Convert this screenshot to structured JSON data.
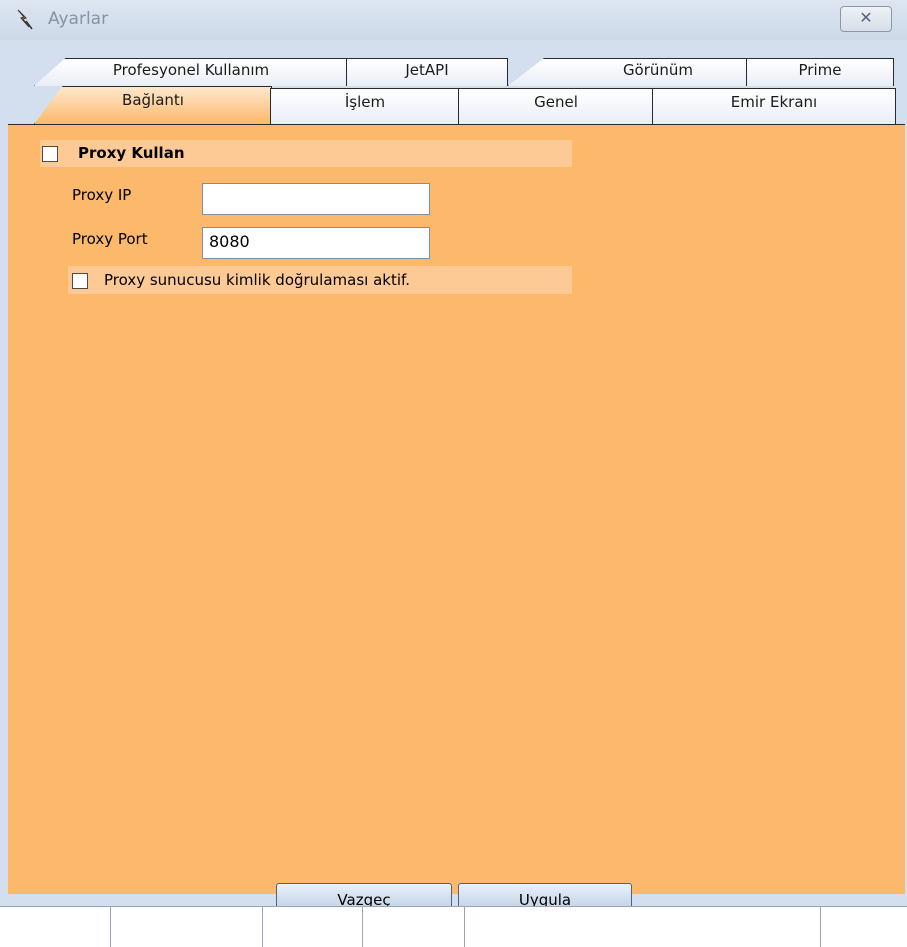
{
  "window": {
    "title": "Ayarlar",
    "close_glyph": "✕",
    "icon": "lightning-app-icon"
  },
  "tabs": {
    "row_back": [
      {
        "label": "Profesyonel Kullanım"
      },
      {
        "label": "JetAPI"
      },
      {
        "label": "Görünüm"
      },
      {
        "label": "Prime"
      }
    ],
    "row_front": [
      {
        "label": "Bağlantı",
        "active": true
      },
      {
        "label": "İşlem"
      },
      {
        "label": "Genel"
      },
      {
        "label": "Emir Ekranı"
      }
    ]
  },
  "proxy": {
    "use_proxy_label": "Proxy Kullan",
    "use_proxy_checked": false,
    "ip_label": "Proxy IP",
    "ip_value": "",
    "port_label": "Proxy Port",
    "port_value": "8080",
    "auth_label": "Proxy sunucusu kimlik doğrulaması aktif.",
    "auth_checked": false
  },
  "buttons": {
    "cancel_label": "Vazgeç",
    "apply_label": "Uygula"
  },
  "colors": {
    "panel_bg": "#fdb96b",
    "titlebar": "#d3dfee"
  }
}
